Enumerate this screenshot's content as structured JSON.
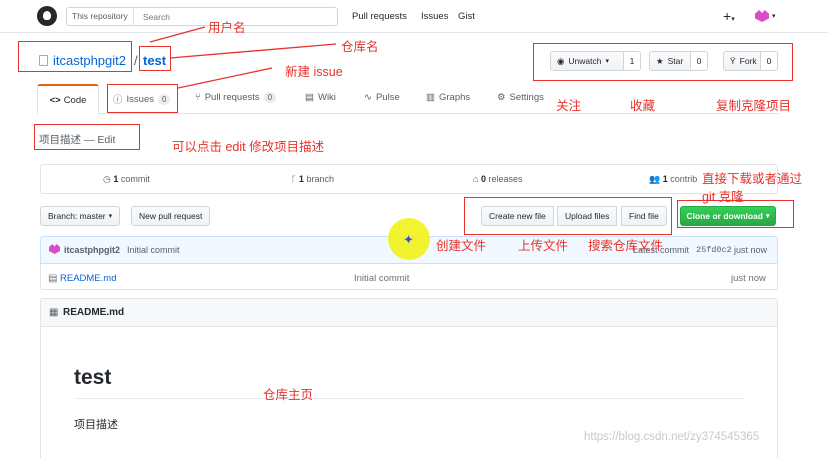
{
  "header": {
    "search_scope": "This repository",
    "search_placeholder": "Search",
    "nav": [
      "Pull requests",
      "Issues",
      "Gist"
    ],
    "plus": "+",
    "caret": "▾"
  },
  "repo": {
    "owner": "itcastphpgit2",
    "slash": "/",
    "name": "test"
  },
  "actions": {
    "watch_label": "Unwatch",
    "watch_count": "1",
    "star_label": "Star",
    "star_count": "0",
    "fork_label": "Fork",
    "fork_count": "0"
  },
  "tabs": {
    "code": "Code",
    "issues": "Issues",
    "issues_count": "0",
    "pulls": "Pull requests",
    "pulls_count": "0",
    "wiki": "Wiki",
    "pulse": "Pulse",
    "graphs": "Graphs",
    "settings": "Settings"
  },
  "description": "项目描述 — Edit",
  "summary": {
    "commits_n": "1",
    "commits_label": "commit",
    "branches_n": "1",
    "branches_label": "branch",
    "releases_n": "0",
    "releases_label": "releases",
    "contrib_n": "1",
    "contrib_label": "contrib"
  },
  "toolbar": {
    "branch_label": "Branch: master",
    "new_pr": "New pull request",
    "create_file": "Create new file",
    "upload_files": "Upload files",
    "find_file": "Find file",
    "clone": "Clone or download"
  },
  "commit": {
    "author": "itcastphpgit2",
    "message": "Initial commit",
    "latest_label": "Latest commit",
    "sha": "25fd0c2",
    "time": "just now"
  },
  "files": [
    {
      "name": "README.md",
      "message": "Initial commit",
      "time": "just now"
    }
  ],
  "readme": {
    "filename": "README.md",
    "title": "test",
    "body": "项目描述"
  },
  "annotations": {
    "username": "用户名",
    "repo_name": "仓库名",
    "new_issue": "新建  issue",
    "watch": "关注",
    "star": "收藏",
    "fork": "复制克隆项目",
    "edit": "可以点击  edit    修改项目描述",
    "clone_line1": "直接下载或者通过",
    "clone_line2": "git  克隆",
    "create": "创建文件",
    "upload": "上传文件",
    "search": "搜索仓库文件",
    "home": "仓库主页"
  },
  "watermark": "https://blog.csdn.net/zy374545365",
  "colors": {
    "accent": "#0366d6",
    "annotation": "#e8322b",
    "clone_button": "#28a745",
    "highlight_cursor": "#f2f21a"
  }
}
